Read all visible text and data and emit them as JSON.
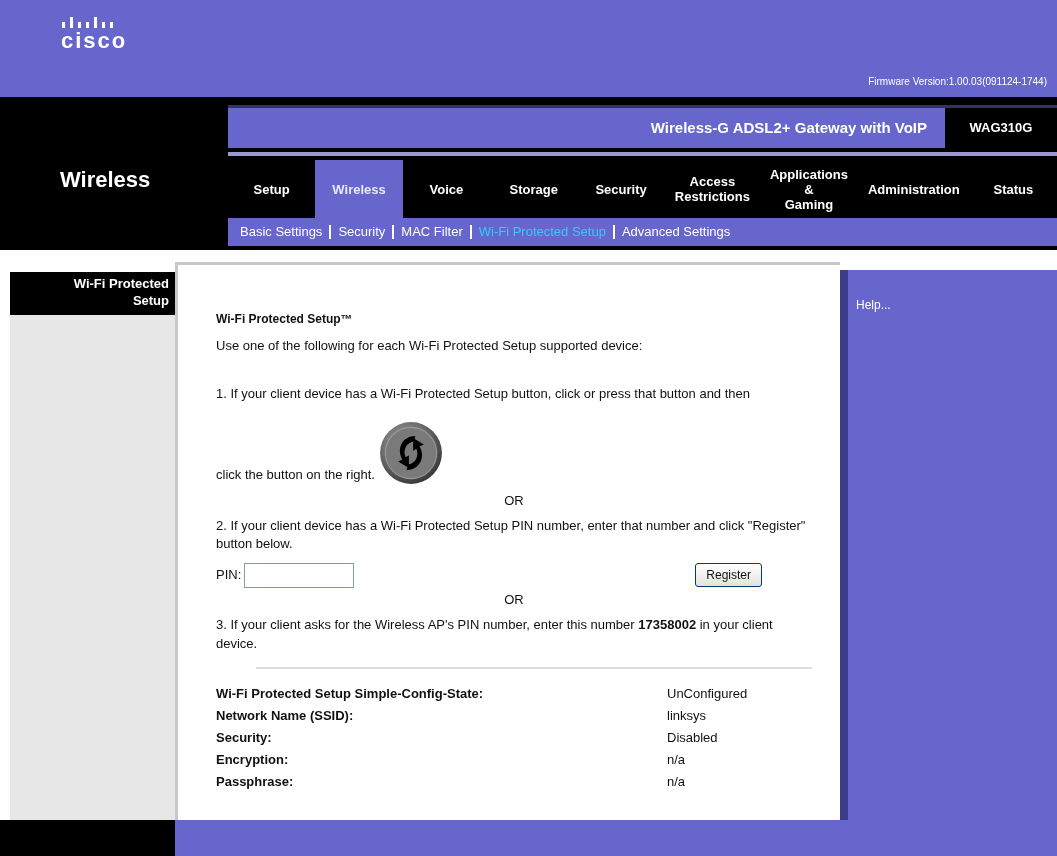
{
  "header": {
    "logo": "cisco",
    "firmware": "Firmware Version:1.00.03(091124-1744)"
  },
  "product": {
    "name": "Wireless-G ADSL2+ Gateway with VoIP",
    "model": "WAG310G"
  },
  "section_title": "Wireless",
  "tabs": [
    {
      "label": "Setup",
      "selected": false
    },
    {
      "label": "Wireless",
      "selected": true
    },
    {
      "label": "Voice",
      "selected": false
    },
    {
      "label": "Storage",
      "selected": false
    },
    {
      "label": "Security",
      "selected": false
    },
    {
      "label": "Access\nRestrictions",
      "selected": false
    },
    {
      "label": "Applications\n&\nGaming",
      "selected": false
    },
    {
      "label": "Administration",
      "selected": false
    },
    {
      "label": "Status",
      "selected": false
    }
  ],
  "subtabs": [
    {
      "label": "Basic Settings",
      "selected": false
    },
    {
      "label": "Security",
      "selected": false
    },
    {
      "label": "MAC Filter",
      "selected": false
    },
    {
      "label": "Wi-Fi Protected Setup",
      "selected": true
    },
    {
      "label": "Advanced Settings",
      "selected": false
    }
  ],
  "sidebar_heading": "Wi-Fi Protected Setup",
  "content": {
    "title": "Wi-Fi Protected Setup™",
    "intro": "Use one of the following for each Wi-Fi Protected Setup supported device:",
    "step_1": "1. If your client device has a Wi-Fi Protected Setup button, click or press that button and then",
    "step_1_end": "click the button on the right.",
    "or_1": "OR",
    "step_2": "2. If your client device has a Wi-Fi Protected Setup PIN number, enter that number and click \"Register\" button below.",
    "pin_label": "PIN:",
    "register_button": "Register",
    "or_2": "OR",
    "step_3": "3. If your client asks for the Wireless AP's PIN number, enter this number **17358002** in your client device.",
    "status": [
      {
        "label": "Wi-Fi Protected Setup Simple-Config-State:",
        "value": "UnConfigured"
      },
      {
        "label": "Network Name (SSID):",
        "value": "linksys"
      },
      {
        "label": "Security:",
        "value": "Disabled"
      },
      {
        "label": "Encryption:",
        "value": "n/a"
      },
      {
        "label": "Passphrase:",
        "value": "n/a"
      }
    ]
  },
  "help": "Help..."
}
